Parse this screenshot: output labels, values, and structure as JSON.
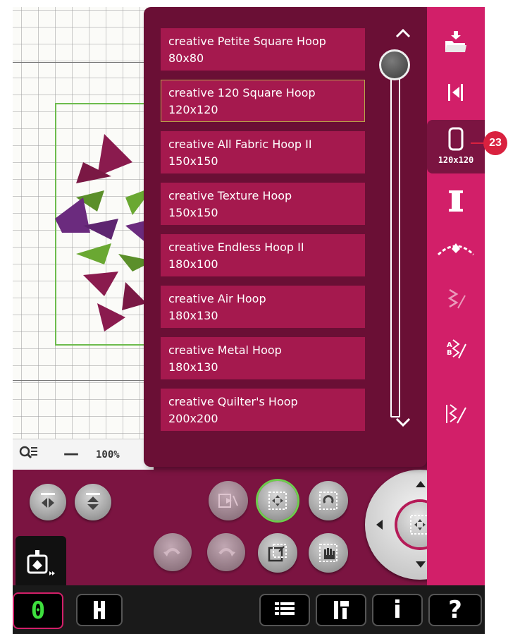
{
  "zoom": {
    "value": "100%",
    "minus_label": "—"
  },
  "coordinate": ".0",
  "hoop_tab": {
    "label": "120x120"
  },
  "callout": {
    "number": "23"
  },
  "hoops": [
    {
      "name": "creative Petite Square Hoop",
      "size": "80x80",
      "selected": false
    },
    {
      "name": "creative 120 Square Hoop",
      "size": "120x120",
      "selected": true
    },
    {
      "name": "creative All Fabric Hoop II",
      "size": "150x150",
      "selected": false
    },
    {
      "name": "creative Texture Hoop",
      "size": "150x150",
      "selected": false
    },
    {
      "name": "creative Endless Hoop II",
      "size": "180x100",
      "selected": false
    },
    {
      "name": "creative Air Hoop",
      "size": "180x130",
      "selected": false
    },
    {
      "name": "creative Metal Hoop",
      "size": "180x130",
      "selected": false
    },
    {
      "name": "creative Quilter's Hoop",
      "size": "200x200",
      "selected": false
    }
  ],
  "stitch_counter": "0",
  "bottom_bar": {
    "help_label": "?",
    "info_label": "i"
  },
  "colors": {
    "accent": "#d21f69",
    "panel": "#6a0f35",
    "item": "#a5194e",
    "background": "#7b1441",
    "selected_border": "#b7a848",
    "design_frame": "#6dbb4d"
  }
}
